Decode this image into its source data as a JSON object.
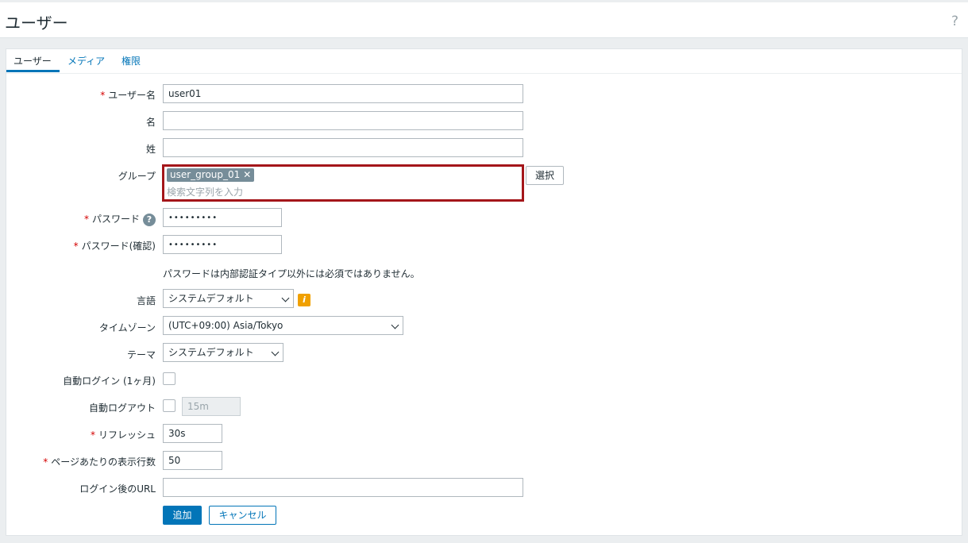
{
  "page": {
    "title": "ユーザー",
    "help": "?"
  },
  "tabs": [
    {
      "label": "ユーザー",
      "active": true
    },
    {
      "label": "メディア",
      "active": false
    },
    {
      "label": "権限",
      "active": false
    }
  ],
  "form": {
    "username": {
      "label": "ユーザー名",
      "value": "user01",
      "required": "*"
    },
    "firstname": {
      "label": "名",
      "value": ""
    },
    "lastname": {
      "label": "姓",
      "value": ""
    },
    "group": {
      "label": "グループ",
      "chip": "user_group_01",
      "chip_remove": "✕",
      "placeholder": "検索文字列を入力",
      "select_button": "選択"
    },
    "password": {
      "label": "パスワード",
      "value": "•••••••••",
      "required": "*",
      "help": "?"
    },
    "password_confirm": {
      "label": "パスワード(確認)",
      "value": "•••••••••",
      "required": "*"
    },
    "password_note": "パスワードは内部認証タイプ以外には必須ではありません。",
    "language": {
      "label": "言語",
      "value": "システムデフォルト",
      "info": "i"
    },
    "timezone": {
      "label": "タイムゾーン",
      "value": "(UTC+09:00) Asia/Tokyo"
    },
    "theme": {
      "label": "テーマ",
      "value": "システムデフォルト"
    },
    "autologin": {
      "label": "自動ログイン (1ヶ月)"
    },
    "autologout": {
      "label": "自動ログアウト",
      "value": "15m"
    },
    "refresh": {
      "label": "リフレッシュ",
      "value": "30s",
      "required": "*"
    },
    "rows_per_page": {
      "label": "ページあたりの表示行数",
      "value": "50",
      "required": "*"
    },
    "url": {
      "label": "ログイン後のURL",
      "value": ""
    }
  },
  "buttons": {
    "add": "追加",
    "cancel": "キャンセル"
  },
  "colors": {
    "accent": "#0275b8",
    "highlight": "#a4161a",
    "info": "#f0a000"
  }
}
